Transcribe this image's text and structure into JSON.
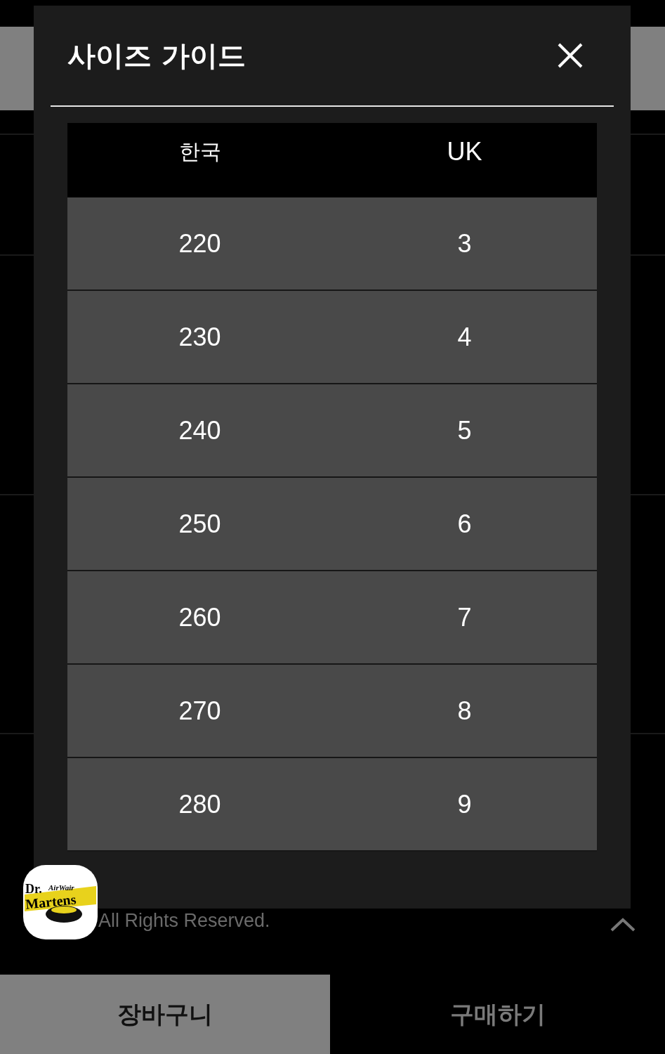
{
  "modal": {
    "title": "사이즈 가이드",
    "table": {
      "columns": [
        "한국",
        "UK"
      ],
      "rows": [
        [
          "220",
          "3"
        ],
        [
          "230",
          "4"
        ],
        [
          "240",
          "5"
        ],
        [
          "250",
          "6"
        ],
        [
          "260",
          "7"
        ],
        [
          "270",
          "8"
        ],
        [
          "280",
          "9"
        ]
      ]
    }
  },
  "footer": {
    "copyright": "All Rights Reserved."
  },
  "logo": {
    "lines": [
      "Dr.",
      "AirWair",
      "Martens"
    ]
  },
  "bottom_bar": {
    "buttons": [
      {
        "label": "장바구니",
        "kind": "filled"
      },
      {
        "label": "구매하기",
        "kind": "plain"
      }
    ]
  }
}
